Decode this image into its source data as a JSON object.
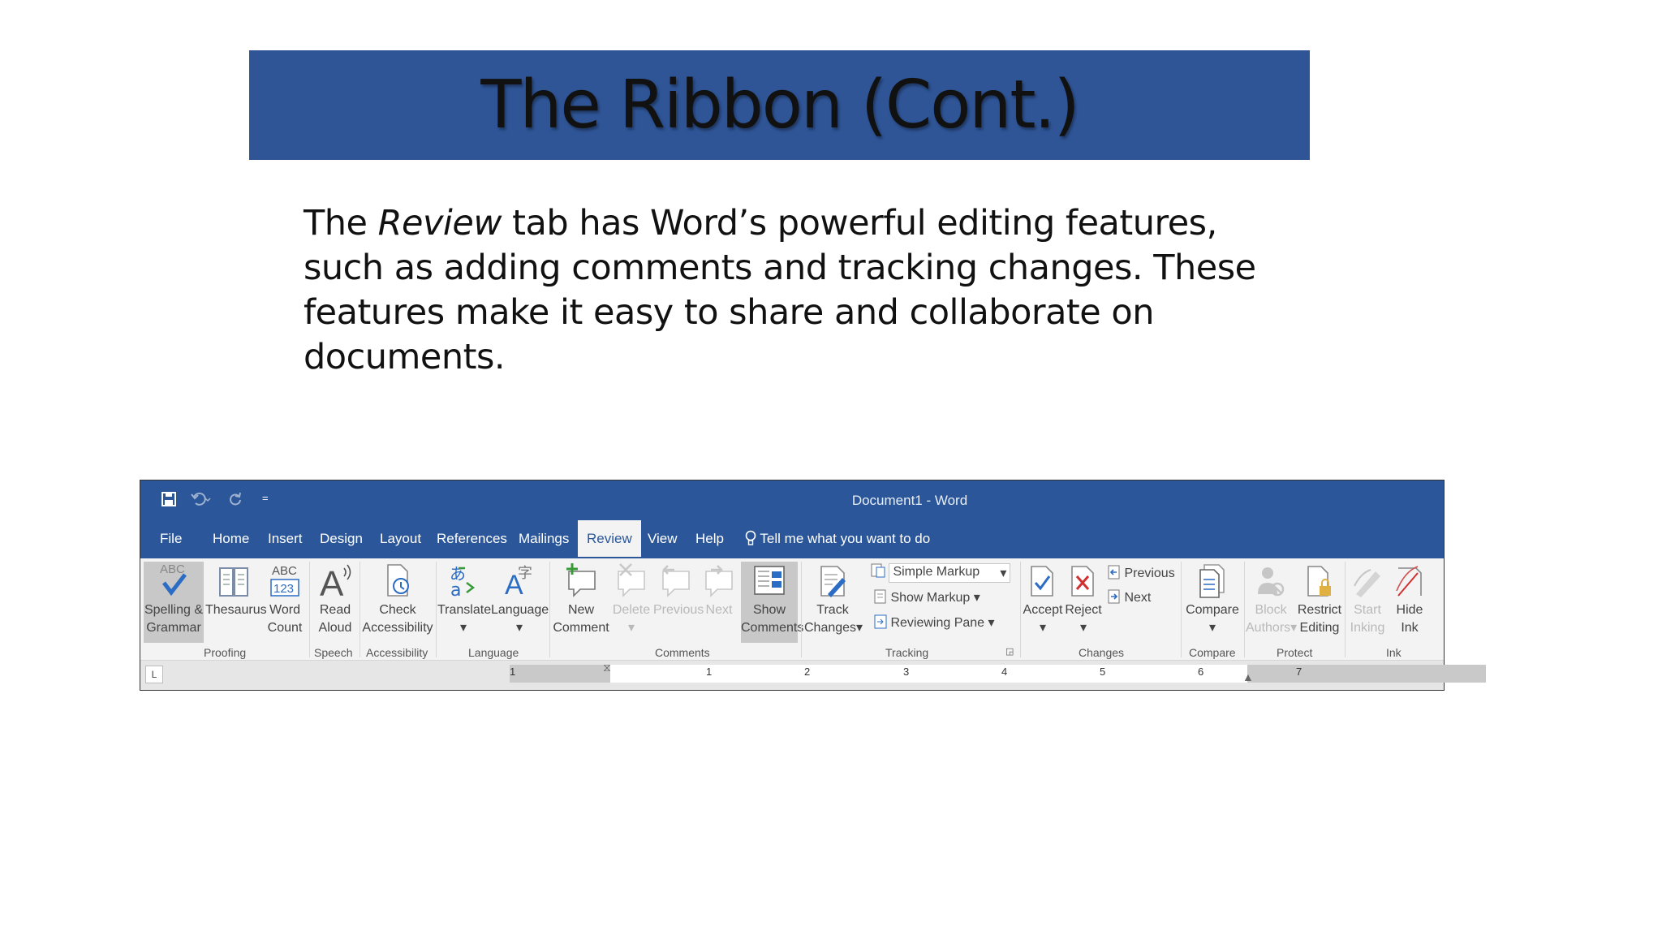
{
  "slide": {
    "title": "The Ribbon (Cont.)",
    "body_prefix": "The ",
    "body_italic": "Review",
    "body_suffix": " tab has Word’s powerful editing features, such as adding comments and tracking changes. These features make it easy to share and collaborate on documents."
  },
  "word": {
    "window_title": "Document1  -  Word",
    "qat_more": "=",
    "tabs": [
      "File",
      "Home",
      "Insert",
      "Design",
      "Layout",
      "References",
      "Mailings",
      "Review",
      "View",
      "Help"
    ],
    "tell_me": "Tell me what you want to do",
    "buttons": {
      "spelling": [
        "Spelling &",
        "Grammar"
      ],
      "spelling_icon_text": "ABC",
      "thesaurus": "Thesaurus",
      "word_count": [
        "Word",
        "Count"
      ],
      "word_count_icon_top": "ABC",
      "word_count_icon_bottom": "123",
      "read_aloud": [
        "Read",
        "Aloud"
      ],
      "check_access": [
        "Check",
        "Accessibility"
      ],
      "translate": "Translate",
      "language": "Language",
      "new_comment": [
        "New",
        "Comment"
      ],
      "delete": "Delete",
      "previous_c": "Previous",
      "next_c": "Next",
      "show_comments": [
        "Show",
        "Comments"
      ],
      "track_changes": [
        "Track",
        "Changes"
      ],
      "simple_markup": "Simple Markup",
      "show_markup": "Show Markup",
      "reviewing_pane": "Reviewing Pane",
      "accept": "Accept",
      "reject": "Reject",
      "previous": "Previous",
      "next": "Next",
      "compare": "Compare",
      "block_authors": [
        "Block",
        "Authors"
      ],
      "restrict_editing": [
        "Restrict",
        "Editing"
      ],
      "start_inking": [
        "Start",
        "Inking"
      ],
      "hide_ink": [
        "Hide",
        "Ink"
      ]
    },
    "groups": [
      "Proofing",
      "Speech",
      "Accessibility",
      "Language",
      "Comments",
      "Tracking",
      "Changes",
      "Compare",
      "Protect",
      "Ink"
    ],
    "ruler_tab_glyph": "L",
    "ruler_numbers": [
      "1",
      "1",
      "2",
      "3",
      "4",
      "5",
      "6",
      "7"
    ],
    "colors": {
      "ribbon_blue": "#2b579a",
      "slide_title_bg": "#2f5597"
    }
  }
}
